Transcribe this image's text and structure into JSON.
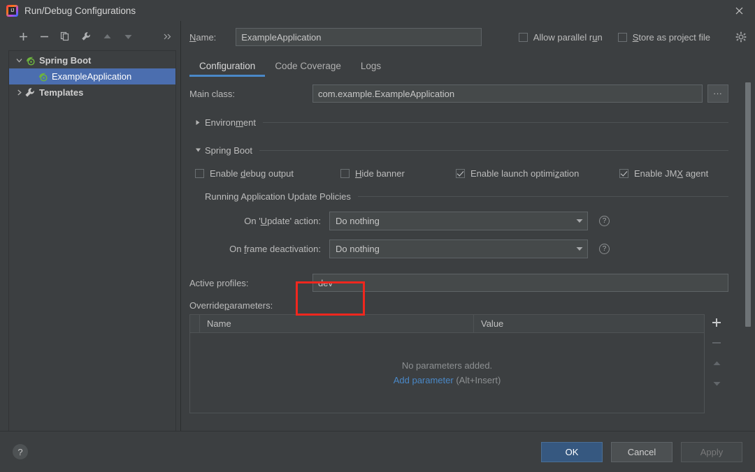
{
  "window": {
    "title": "Run/Debug Configurations",
    "app_icon": "intellij-idea-logo-icon",
    "close_icon": "close-icon"
  },
  "left_pane": {
    "toolbar": [
      {
        "name": "add",
        "icon": "plus-icon",
        "enabled": true
      },
      {
        "name": "remove",
        "icon": "minus-icon",
        "enabled": true
      },
      {
        "name": "copy",
        "icon": "copy-icon",
        "enabled": true
      },
      {
        "name": "edit-templates",
        "icon": "wrench-icon",
        "enabled": true
      },
      {
        "name": "move-up",
        "icon": "arrow-up-icon",
        "enabled": false
      },
      {
        "name": "move-down",
        "icon": "arrow-down-icon",
        "enabled": false
      },
      {
        "name": "more",
        "icon": "chevron-double-right-icon",
        "enabled": true
      }
    ],
    "tree": [
      {
        "label": "Spring Boot",
        "icon": "spring-boot-icon",
        "expanded": true,
        "level": 0,
        "selected": false
      },
      {
        "label": "ExampleApplication",
        "icon": "spring-boot-icon",
        "level": 1,
        "selected": true
      },
      {
        "label": "Templates",
        "icon": "wrench-icon",
        "expanded": false,
        "level": 0,
        "selected": false
      }
    ]
  },
  "header": {
    "name_label": "Name:",
    "name_label_mnemonic": "N",
    "name_value": "ExampleApplication",
    "allow_parallel_run": {
      "label_pre": "Allow parallel r",
      "mnemonic": "u",
      "label_post": "n",
      "checked": false
    },
    "store_as_project_file": {
      "mnemonic": "S",
      "label_post": "tore as project file",
      "checked": false
    },
    "settings_icon": "gear-icon"
  },
  "tabs": [
    {
      "label": "Configuration",
      "active": true
    },
    {
      "label": "Code Coverage",
      "active": false
    },
    {
      "label": "Logs",
      "active": false
    }
  ],
  "main_class": {
    "label": "Main class:",
    "value": "com.example.ExampleApplication",
    "browse_label": "...",
    "browse_icon": "ellipsis-icon"
  },
  "environment_section": {
    "title": "Environment",
    "mnemonic_prefix": "Environ",
    "mnemonic": "m",
    "mnemonic_suffix": "ent",
    "expanded": false,
    "triangle_icon": "triangle-right-icon"
  },
  "spring_boot_section": {
    "title_prefix": "Sprin",
    "mnemonic": "g",
    "title_suffix": " Boot",
    "expanded": true,
    "triangle_icon": "triangle-down-icon",
    "checkboxes": [
      {
        "pre": "Enable ",
        "mnemonic": "d",
        "post": "ebug output",
        "checked": false,
        "name": "enable-debug-output"
      },
      {
        "pre": "",
        "mnemonic": "H",
        "post": "ide banner",
        "checked": false,
        "name": "hide-banner"
      },
      {
        "pre": "Enable launch optimi",
        "mnemonic": "z",
        "post": "ation",
        "checked": true,
        "name": "enable-launch-optimization"
      },
      {
        "pre": "Enable JM",
        "mnemonic": "X",
        "post": " agent",
        "checked": true,
        "name": "enable-jmx-agent"
      }
    ]
  },
  "update_policies": {
    "title": "Running Application Update Policies",
    "rows": [
      {
        "label_pre": "On '",
        "mnemonic": "U",
        "label_post": "pdate' action:",
        "value": "Do nothing",
        "help_icon": "question-circle-icon",
        "name": "on-update-action"
      },
      {
        "label_pre": "On ",
        "mnemonic": "f",
        "label_post": "rame deactivation:",
        "value": "Do nothing",
        "help_icon": "question-circle-icon",
        "name": "on-frame-deactivation"
      }
    ],
    "dropdown_icon": "chevron-down-icon"
  },
  "active_profiles": {
    "label": "Active profiles:",
    "value": "dev",
    "highlight_color": "#f0271e"
  },
  "override_parameters": {
    "label_pre": "Override ",
    "mnemonic": "p",
    "label_post": "arameters:",
    "columns": [
      "Name",
      "Value"
    ],
    "rows": [],
    "empty_text": "No parameters added.",
    "add_link": "Add parameter",
    "add_shortcut": "(Alt+Insert)",
    "side_buttons": [
      {
        "name": "add-parameter",
        "icon": "plus-icon",
        "enabled": true
      },
      {
        "name": "remove-parameter",
        "icon": "minus-icon",
        "enabled": false
      },
      {
        "name": "move-parameter-up",
        "icon": "arrow-up-icon",
        "enabled": false
      },
      {
        "name": "move-parameter-down",
        "icon": "arrow-down-icon",
        "enabled": false
      }
    ]
  },
  "footer": {
    "help_label": "?",
    "ok_label": "OK",
    "cancel_label": "Cancel",
    "apply_label": "Apply",
    "apply_enabled": false
  },
  "colors": {
    "dialog_bg": "#3c3f41",
    "input_bg": "#45494a",
    "selection_blue": "#4b6eaf",
    "accent_blue": "#4a88c7",
    "primary_button": "#365880",
    "link_blue": "#4a88c7",
    "highlight_red": "#f0271e",
    "spring_green": "#6db33f"
  }
}
